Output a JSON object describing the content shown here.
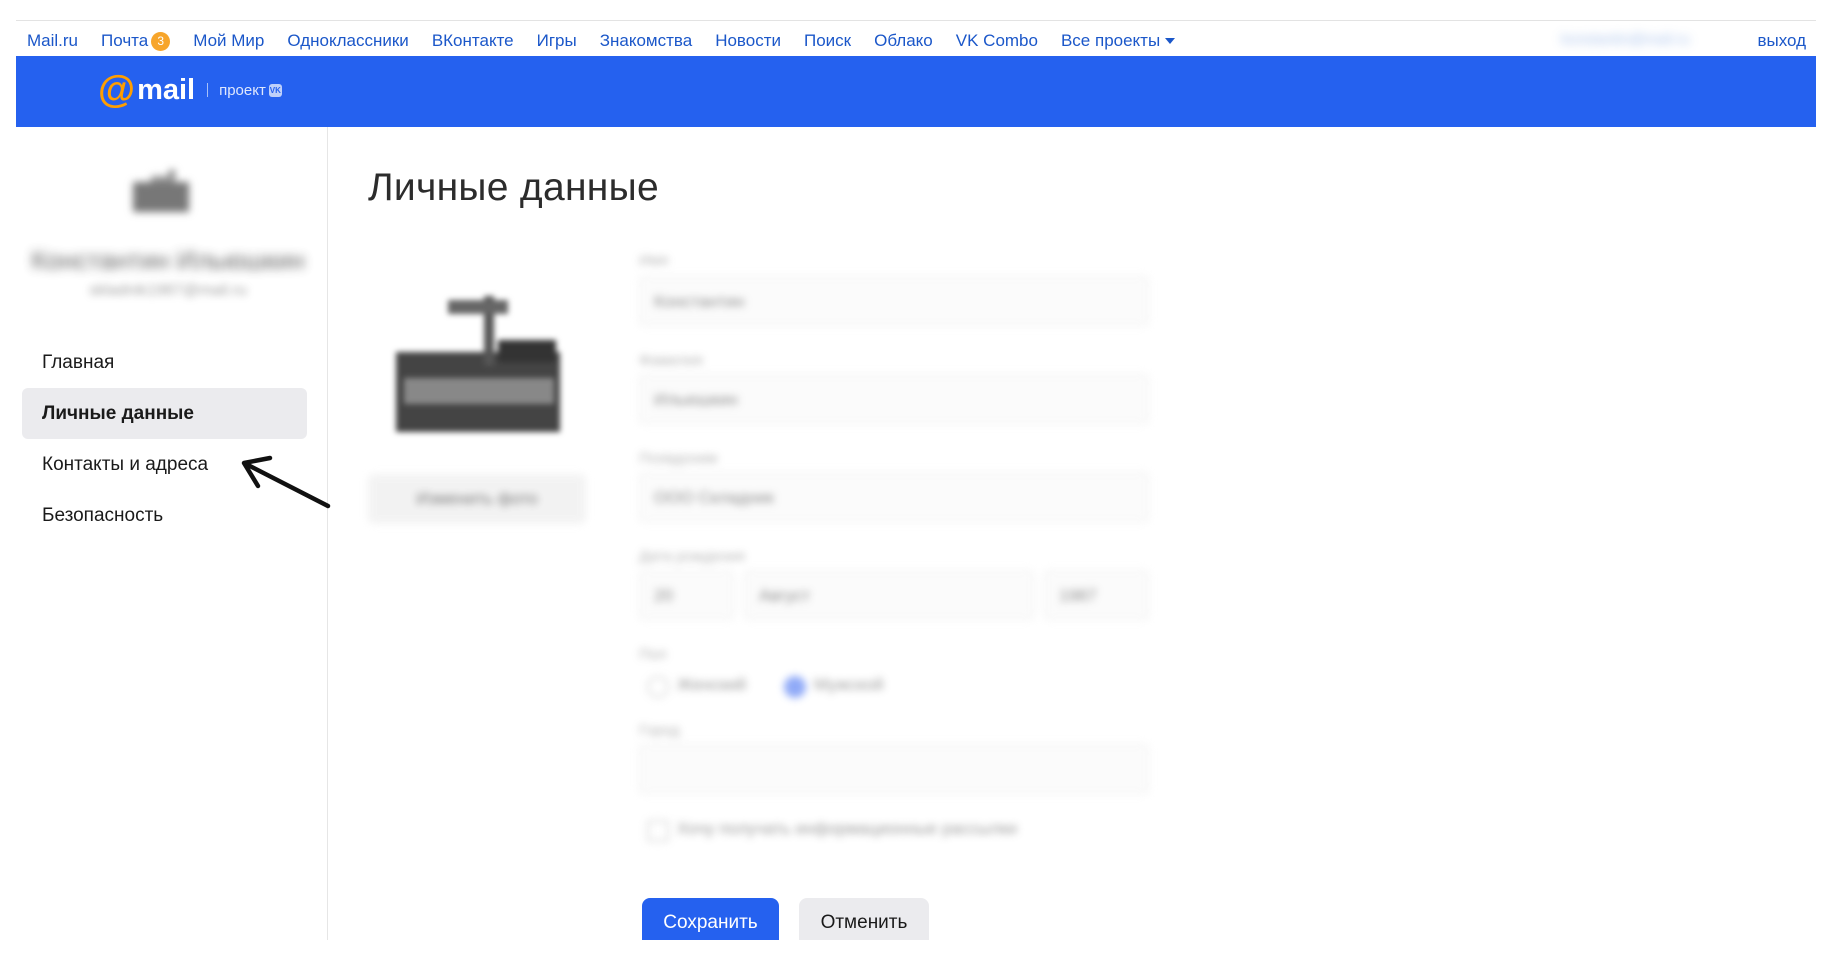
{
  "portal": {
    "links": [
      {
        "label": "Mail.ru"
      },
      {
        "label": "Почта",
        "badge": "3"
      },
      {
        "label": "Мой Мир"
      },
      {
        "label": "Одноклассники"
      },
      {
        "label": "ВКонтакте"
      },
      {
        "label": "Игры"
      },
      {
        "label": "Знакомства"
      },
      {
        "label": "Новости"
      },
      {
        "label": "Поиск"
      },
      {
        "label": "Облако"
      },
      {
        "label": "VK Combo"
      }
    ],
    "all_projects": "Все проекты",
    "exit": "выход"
  },
  "header": {
    "logo_at": "@",
    "logo_text": "mail",
    "project": "проект"
  },
  "sidebar": {
    "nav": [
      {
        "label": "Главная",
        "active": false
      },
      {
        "label": "Личные данные",
        "active": true
      },
      {
        "label": "Контакты и адреса",
        "active": false
      },
      {
        "label": "Безопасность",
        "active": false
      }
    ]
  },
  "main": {
    "title": "Личные данные"
  },
  "actions": {
    "save": "Сохранить",
    "cancel": "Отменить"
  },
  "colors": {
    "brand_blue": "#2561ef",
    "link_blue": "#1b57c9",
    "badge_orange": "#f7a52b",
    "logo_orange": "#ff9e00",
    "active_bg": "#ebebee"
  }
}
